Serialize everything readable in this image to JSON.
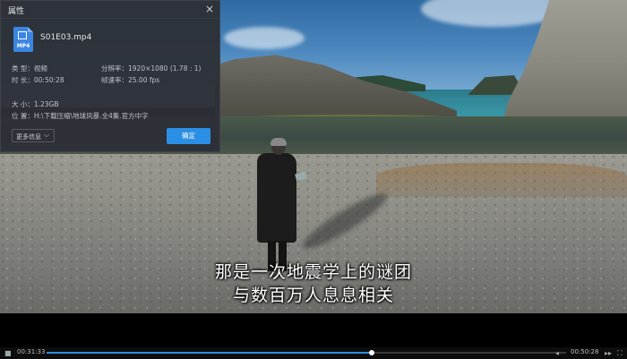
{
  "dialog": {
    "title": "属性",
    "close_glyph": "×",
    "file_name": "S01E03.mp4",
    "file_icon_label": "MP4",
    "type": "类 型：视频",
    "duration": "时 长：00:50:28",
    "resolution": "分辨率：1920×1080 (1.78 : 1)",
    "framerate": "帧速率：25.00 fps",
    "size": "大 小：1.23GB",
    "location": "位 置：H:\\下载压缩\\地球风暴.全4集.官方中字",
    "more_button": "更多信息",
    "more_chevron": "⌵",
    "ok_button": "确定",
    "accent_color": "#2b8fe5"
  },
  "subtitles": {
    "line1": "那是一次地震学上的谜团",
    "line2": "与数百万人息息相关"
  },
  "player": {
    "current_time": "00:31:33",
    "total_time": "00:50:28",
    "progress_fraction": 0.625,
    "progress_color": "#2d8fe0",
    "icons": [
      "stop-icon",
      "prev-icon",
      "next-icon",
      "fullscreen-icon"
    ]
  }
}
